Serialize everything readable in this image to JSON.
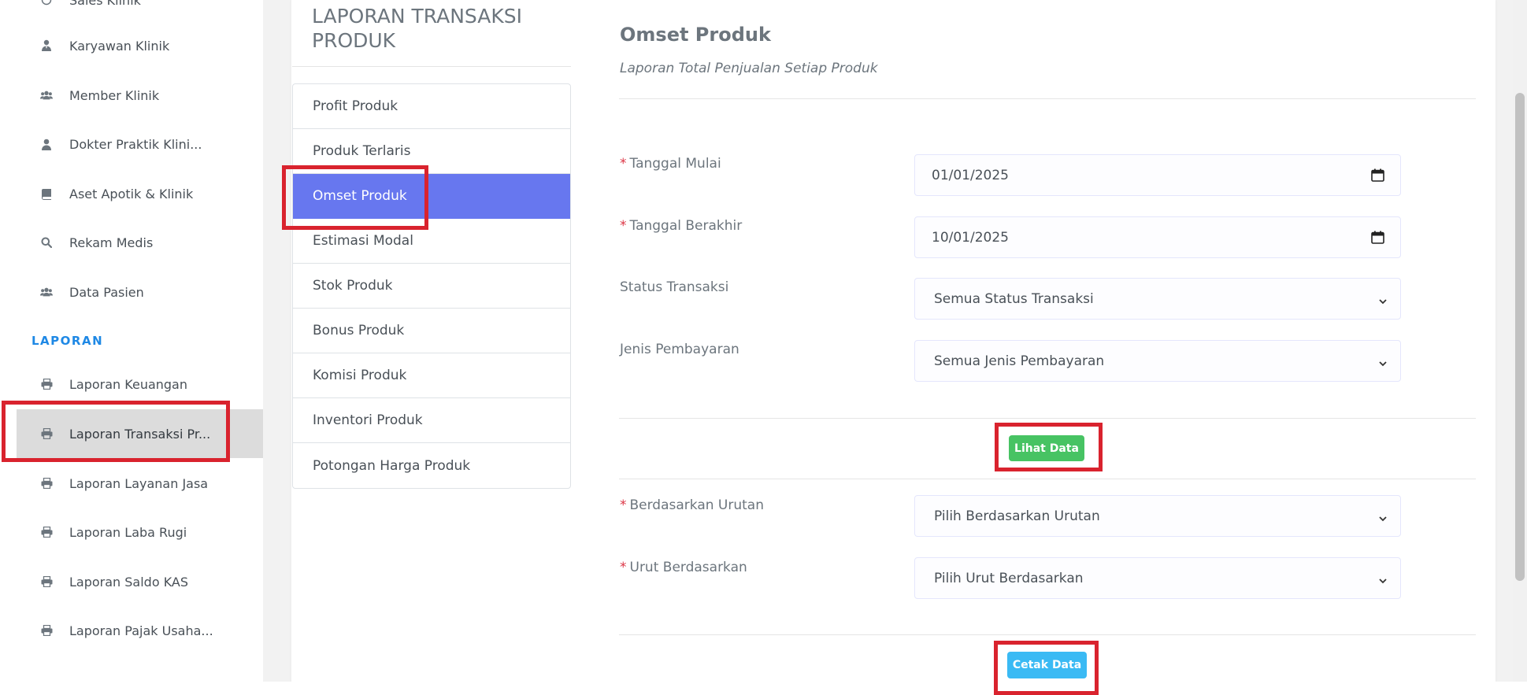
{
  "sidebar": {
    "partial_item": "Sales Klinik",
    "items": [
      {
        "label": "Karyawan Klinik",
        "icon": "user-tie-icon"
      },
      {
        "label": "Member Klinik",
        "icon": "users-icon"
      },
      {
        "label": "Dokter Praktik Klini...",
        "icon": "user-icon"
      },
      {
        "label": "Aset Apotik & Klinik",
        "icon": "book-icon"
      },
      {
        "label": "Rekam Medis",
        "icon": "search-icon"
      },
      {
        "label": "Data Pasien",
        "icon": "users-icon"
      }
    ],
    "section_label": "LAPORAN",
    "report_items": [
      {
        "label": "Laporan Keuangan",
        "icon": "print-icon"
      },
      {
        "label": "Laporan Transaksi Pr...",
        "icon": "print-icon",
        "active": true
      },
      {
        "label": "Laporan Layanan Jasa",
        "icon": "print-icon"
      },
      {
        "label": "Laporan Laba Rugi",
        "icon": "print-icon"
      },
      {
        "label": "Laporan Saldo KAS",
        "icon": "print-icon"
      },
      {
        "label": "Laporan Pajak Usaha...",
        "icon": "print-icon"
      }
    ]
  },
  "report_panel": {
    "title": "LAPORAN TRANSAKSI PRODUK",
    "menu": [
      "Profit Produk",
      "Produk Terlaris",
      "Omset Produk",
      "Estimasi Modal",
      "Stok Produk",
      "Bonus Produk",
      "Komisi Produk",
      "Inventori Produk",
      "Potongan Harga Produk"
    ],
    "active_index": 2
  },
  "form": {
    "title": "Omset Produk",
    "subtitle": "Laporan Total Penjualan Setiap Produk",
    "tanggal_mulai": {
      "label": "Tanggal Mulai",
      "value": "01/01/2025"
    },
    "tanggal_berakhir": {
      "label": "Tanggal Berakhir",
      "value": "10/01/2025"
    },
    "status_transaksi": {
      "label": "Status Transaksi",
      "value": "Semua Status Transaksi"
    },
    "jenis_pembayaran": {
      "label": "Jenis Pembayaran",
      "value": "Semua Jenis Pembayaran"
    },
    "lihat_button": "Lihat Data",
    "berdasarkan_urutan": {
      "label": "Berdasarkan Urutan",
      "value": "Pilih Berdasarkan Urutan"
    },
    "urut_berdasarkan": {
      "label": "Urut Berdasarkan",
      "value": "Pilih Urut Berdasarkan"
    },
    "cetak_button": "Cetak Data",
    "required_mark": "*"
  },
  "colors": {
    "accent": "#6777ef",
    "section": "#1e88e5",
    "success": "#47c363",
    "info": "#3abaf4",
    "required": "#dc3545",
    "highlight": "#d9232e"
  }
}
